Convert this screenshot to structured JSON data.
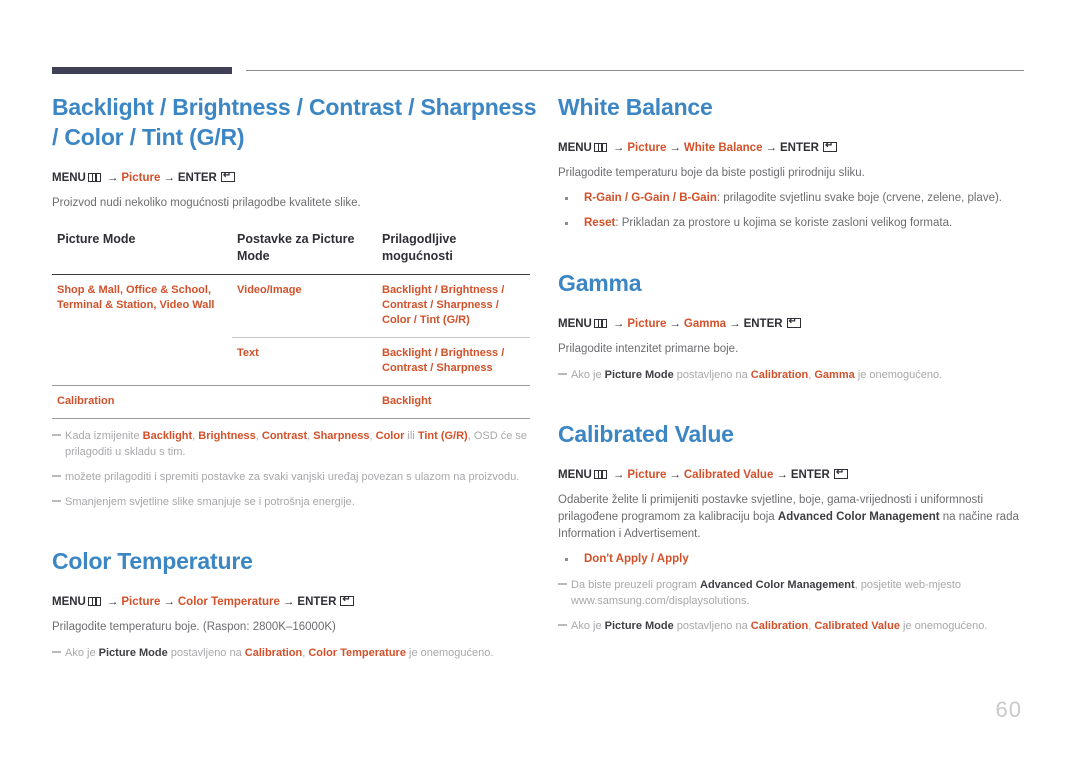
{
  "page": {
    "number": "60"
  },
  "icons": {
    "menu": "menu-grid-icon",
    "enter": "enter-return-icon"
  },
  "left": {
    "heading": "Backlight / Brightness / Contrast / Sharpness / Color / Tint (G/R)",
    "menupath": {
      "menu": "MENU",
      "p1": "Picture",
      "enter": "ENTER",
      "arrow": "→"
    },
    "intro": "Proizvod nudi nekoliko mogućnosti prilagodbe kvalitete slike.",
    "table": {
      "headers": [
        "Picture Mode",
        "Postavke za Picture Mode",
        "Prilagodljive mogućnosti"
      ],
      "rows": [
        {
          "mode": "Shop & Mall, Office & School, Terminal & Station, Video Wall",
          "setting": "Video/Image",
          "options": "Backlight /  Brightness / Contrast / Sharpness / Color / Tint (G/R)"
        },
        {
          "mode": "",
          "setting": "Text",
          "options": "Backlight / Brightness / Contrast / Sharpness"
        },
        {
          "mode": "Calibration",
          "setting": "",
          "options": "Backlight"
        }
      ]
    },
    "notes": [
      {
        "pre": "Kada izmijenite ",
        "b1": "Backlight",
        "s1": ", ",
        "b2": "Brightness",
        "s2": ", ",
        "b3": "Contrast",
        "s3": ", ",
        "b4": "Sharpness",
        "s4": ", ",
        "b5": "Color",
        "s5": " ili ",
        "b6": "Tint (G/R)",
        "post": ", OSD će se prilagoditi u skladu s tim."
      },
      {
        "text": "možete prilagoditi i spremiti postavke za svaki vanjski uređaj povezan s ulazom na proizvodu."
      },
      {
        "text": "Smanjenjem svjetline slike smanjuje se i potrošnja energije."
      }
    ],
    "color_temperature": {
      "heading": "Color Temperature",
      "menupath": {
        "menu": "MENU",
        "p1": "Picture",
        "p2": "Color Temperature",
        "enter": "ENTER"
      },
      "body": "Prilagodite temperaturu boje. (Raspon: 2800K–16000K)",
      "note": {
        "pre": "Ako je ",
        "b1": "Picture Mode",
        "mid": " postavljeno na ",
        "o1": "Calibration",
        "sep": ", ",
        "o2": "Color Temperature",
        "post": " je onemogućeno."
      }
    }
  },
  "right": {
    "white_balance": {
      "heading": "White Balance",
      "menupath": {
        "menu": "MENU",
        "p1": "Picture",
        "p2": "White Balance",
        "enter": "ENTER"
      },
      "body": "Prilagodite temperaturu boje da biste postigli prirodniju sliku.",
      "bullets": [
        {
          "term": "R-Gain / G-Gain / B-Gain",
          "desc": ": prilagodite svjetlinu svake boje (crvene, zelene, plave)."
        },
        {
          "term": "Reset",
          "desc": ": Prikladan za prostore u kojima se koriste zasloni velikog formata."
        }
      ]
    },
    "gamma": {
      "heading": "Gamma",
      "menupath": {
        "menu": "MENU",
        "p1": "Picture",
        "p2": "Gamma",
        "enter": "ENTER"
      },
      "body": "Prilagodite intenzitet primarne boje.",
      "note": {
        "pre": "Ako je ",
        "b1": "Picture Mode",
        "mid": " postavljeno na ",
        "o1": "Calibration",
        "sep": ", ",
        "o2": "Gamma",
        "post": " je onemogućeno."
      }
    },
    "calibrated_value": {
      "heading": "Calibrated Value",
      "menupath": {
        "menu": "MENU",
        "p1": "Picture",
        "p2": "Calibrated Value",
        "enter": "ENTER"
      },
      "body_pre": "Odaberite želite li primijeniti postavke svjetline, boje, gama-vrijednosti i uniformnosti prilagođene programom za kalibraciju boja ",
      "body_bold": "Advanced Color Management",
      "body_post": " na načine rada Information i Advertisement.",
      "bullet": "Don't Apply / Apply",
      "note1": {
        "pre": "Da biste preuzeli program ",
        "b1": "Advanced Color Management",
        "post": ", posjetite web-mjesto www.samsung.com/displaysolutions."
      },
      "note2": {
        "pre": "Ako je ",
        "b1": "Picture Mode",
        "mid": " postavljeno na ",
        "o1": "Calibration",
        "sep": ", ",
        "o2": "Calibrated Value",
        "post": " je onemogućeno."
      }
    }
  }
}
